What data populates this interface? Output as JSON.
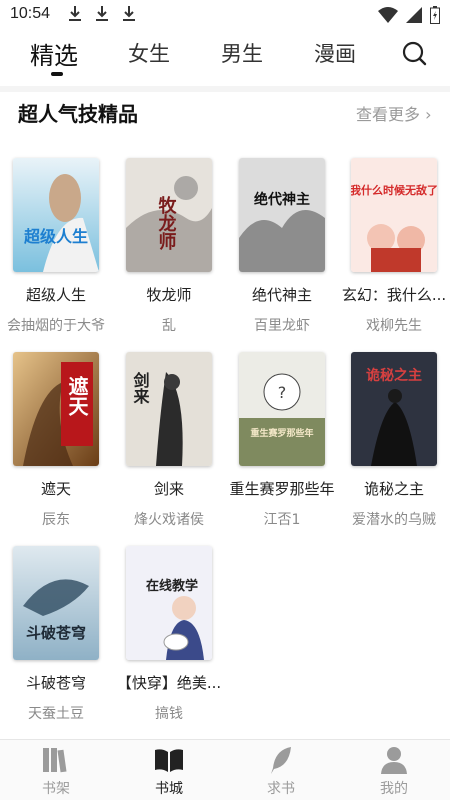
{
  "status_bar": {
    "time": "10:54",
    "icons": [
      "download-icon",
      "download-icon",
      "download-icon",
      "wifi-icon",
      "signal-icon",
      "battery-icon"
    ]
  },
  "top_tabs": [
    {
      "label": "精选",
      "active": true
    },
    {
      "label": "女生",
      "active": false
    },
    {
      "label": "男生",
      "active": false
    },
    {
      "label": "漫画",
      "active": false
    }
  ],
  "search": {
    "icon": "search-icon"
  },
  "section": {
    "title": "超人气技精品",
    "more": "查看更多 ›"
  },
  "books": [
    {
      "title": "超级人生",
      "author": "会抽烟的于大爷",
      "cover_text": "超级人生",
      "cover_color": "#6fb7d6"
    },
    {
      "title": "牧龙师",
      "author": "乱",
      "cover_text": "牧龙师",
      "cover_color": "#d9d4cc"
    },
    {
      "title": "绝代神主",
      "author": "百里龙虾",
      "cover_text": "绝代神主",
      "cover_color": "#cfcfcf"
    },
    {
      "title": "玄幻：我什么...",
      "author": "戏柳先生",
      "cover_text": "我什么时候无敌了",
      "cover_color": "#f4d7cf"
    },
    {
      "title": "遮天",
      "author": "辰东",
      "cover_text": "遮天",
      "cover_color": "#b07a3a"
    },
    {
      "title": "剑来",
      "author": "烽火戏诸侯",
      "cover_text": "剑来",
      "cover_color": "#ddd8cf"
    },
    {
      "title": "重生赛罗那些年",
      "author": "江否1",
      "cover_text": "重生赛罗那些年",
      "cover_color": "#c9ccb9"
    },
    {
      "title": "诡秘之主",
      "author": "爱潜水的乌贼",
      "cover_text": "诡秘之主",
      "cover_color": "#3a3f4a"
    },
    {
      "title": "斗破苍穹",
      "author": "天蚕土豆",
      "cover_text": "斗破苍穹",
      "cover_color": "#c8dbe6"
    },
    {
      "title": "【快穿】绝美...",
      "author": "搞钱",
      "cover_text": "在线教学",
      "cover_color": "#e8e8f4"
    }
  ],
  "bottom_nav": [
    {
      "label": "书架",
      "icon": "bookshelf-icon",
      "active": false
    },
    {
      "label": "书城",
      "icon": "open-book-icon",
      "active": true
    },
    {
      "label": "求书",
      "icon": "feather-icon",
      "active": false
    },
    {
      "label": "我的",
      "icon": "user-icon",
      "active": false
    }
  ]
}
